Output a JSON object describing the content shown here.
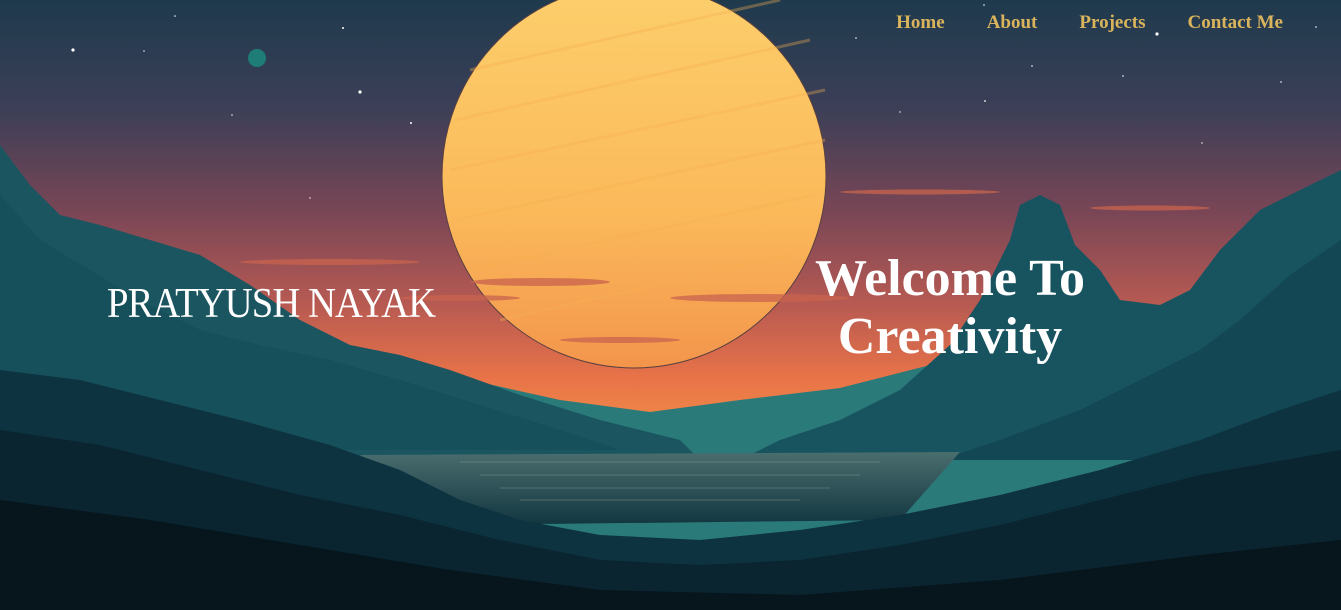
{
  "nav": {
    "items": [
      {
        "label": "Home"
      },
      {
        "label": "About"
      },
      {
        "label": "Projects"
      },
      {
        "label": "Contact Me"
      }
    ]
  },
  "hero": {
    "name": "PRATYUSH NAYAK",
    "welcome_line1": "Welcome To",
    "welcome_line2": "Creativity"
  },
  "colors": {
    "nav_link": "#d9b45c",
    "sun": "#fcc35f",
    "sky_top": "#1f3a4d",
    "sky_mid": "#7a4656",
    "sky_horizon": "#e87348",
    "mountain_dark": "#0b2a33",
    "mountain_teal": "#1f6468"
  },
  "icons": {
    "planet": "small-planet-icon",
    "sun": "sun-icon"
  }
}
